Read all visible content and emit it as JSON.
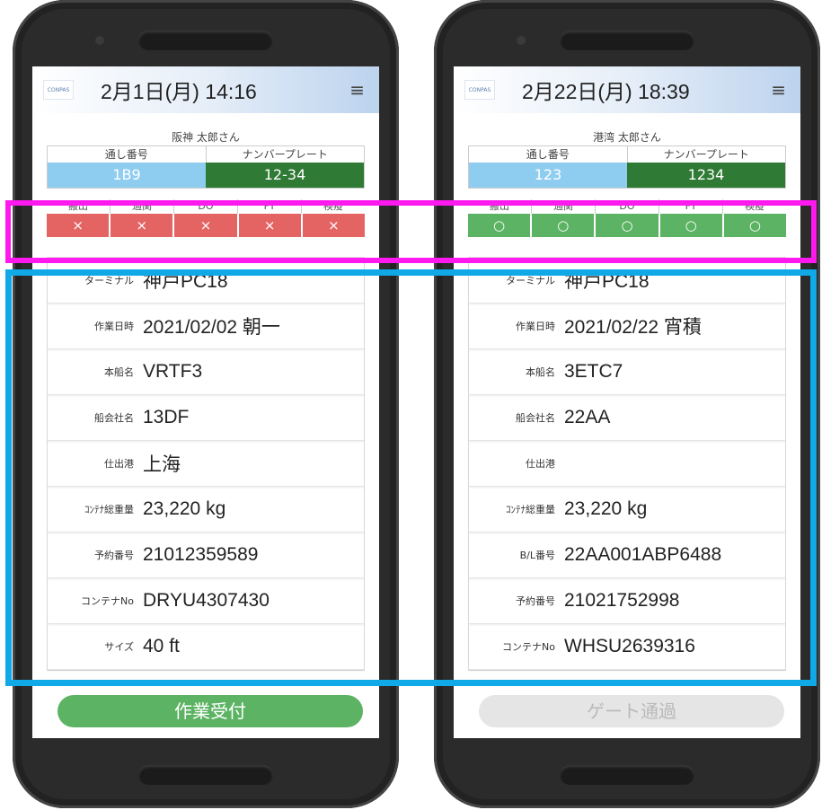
{
  "left": {
    "logo": "CONPAS",
    "datetime": "2月1日(月) 14:16",
    "user": "阪神 太郎さん",
    "seq_label": "通し番号",
    "plate_label": "ナンバープレート",
    "seq_value": "1B9",
    "plate_value": "12-34",
    "status_labels": [
      "搬出",
      "通関",
      "DO",
      "FT",
      "検疫"
    ],
    "status_values": [
      "×",
      "×",
      "×",
      "×",
      "×"
    ],
    "details": [
      {
        "label": "ターミナル",
        "value": "神戸PC18"
      },
      {
        "label": "作業日時",
        "value": "2021/02/02 朝一"
      },
      {
        "label": "本船名",
        "value": "VRTF3"
      },
      {
        "label": "船会社名",
        "value": "13DF"
      },
      {
        "label": "仕出港",
        "value": "上海"
      },
      {
        "label": "ｺﾝﾃﾅ総重量",
        "value": "23,220 kg"
      },
      {
        "label": "予約番号",
        "value": "21012359589"
      },
      {
        "label": "コンテナNo",
        "value": "DRYU4307430"
      },
      {
        "label": "サイズ",
        "value": "40 ft"
      }
    ],
    "action": "作業受付"
  },
  "right": {
    "logo": "CONPAS",
    "datetime": "2月22日(月) 18:39",
    "user": "港湾 太郎さん",
    "seq_label": "通し番号",
    "plate_label": "ナンバープレート",
    "seq_value": "123",
    "plate_value": "1234",
    "status_labels": [
      "搬出",
      "通関",
      "DO",
      "FT",
      "検疫"
    ],
    "status_values": [
      "○",
      "○",
      "○",
      "○",
      "○"
    ],
    "details": [
      {
        "label": "ターミナル",
        "value": "神戸PC18"
      },
      {
        "label": "作業日時",
        "value": "2021/02/22 宵積"
      },
      {
        "label": "本船名",
        "value": "3ETC7"
      },
      {
        "label": "船会社名",
        "value": "22AA"
      },
      {
        "label": "仕出港",
        "value": ""
      },
      {
        "label": "ｺﾝﾃﾅ総重量",
        "value": "23,220 kg"
      },
      {
        "label": "B/L番号",
        "value": "22AA001ABP6488"
      },
      {
        "label": "予約番号",
        "value": "21021752998"
      },
      {
        "label": "コンテナNo",
        "value": "WHSU2639316"
      }
    ],
    "action": "ゲート通過"
  },
  "colors": {
    "highlight_magenta": "#ff19ee",
    "highlight_cyan": "#10a8e6",
    "status_red": "#e46464",
    "status_green": "#5cb363",
    "plate_green": "#2f7a34",
    "seq_blue": "#8fcdf0"
  }
}
